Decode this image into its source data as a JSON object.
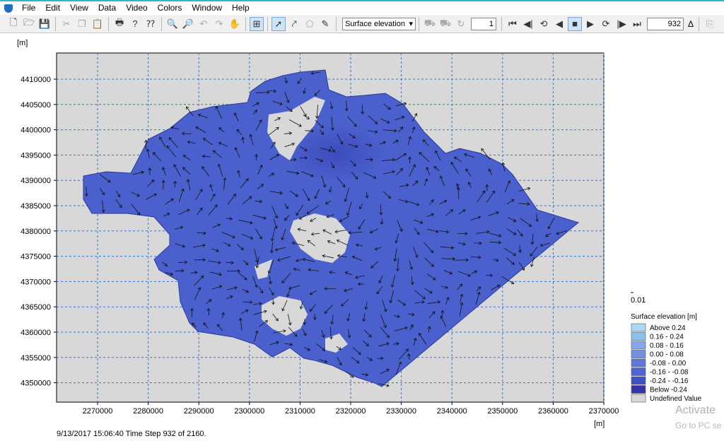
{
  "menu": [
    "File",
    "Edit",
    "View",
    "Data",
    "Video",
    "Colors",
    "Window",
    "Help"
  ],
  "toolbar": {
    "dataset_select": "Surface elevation",
    "step_input": "1",
    "frame_input": "932",
    "delta_label": "Δ"
  },
  "plot": {
    "y_unit": "[m]",
    "x_unit": "[m]",
    "y_ticks": [
      "4410000",
      "4405000",
      "4400000",
      "4395000",
      "4390000",
      "4385000",
      "4380000",
      "4375000",
      "4370000",
      "4365000",
      "4360000",
      "4355000",
      "4350000"
    ],
    "x_ticks": [
      "2270000",
      "2280000",
      "2290000",
      "2300000",
      "2310000",
      "2320000",
      "2330000",
      "2340000",
      "2350000",
      "2360000",
      "2370000"
    ],
    "background": "#d8d8d8",
    "grid_color": "#2d74d6",
    "fill_color": "#4a60cc"
  },
  "legend": {
    "scale_value": "0.01",
    "title": "Surface elevation [m]",
    "items": [
      {
        "label": "Above  0.24",
        "color": "#a8d8f4"
      },
      {
        "label": " 0.16 -  0.24",
        "color": "#8cc1ee"
      },
      {
        "label": " 0.08 -  0.16",
        "color": "#86a6e6"
      },
      {
        "label": " 0.00 -  0.08",
        "color": "#7690e0"
      },
      {
        "label": "-0.08 -  0.00",
        "color": "#5e78d8"
      },
      {
        "label": "-0.16 - -0.08",
        "color": "#4f66cf"
      },
      {
        "label": "-0.24 - -0.16",
        "color": "#3f50c2"
      },
      {
        "label": "Below  -0.24",
        "color": "#3236a8"
      },
      {
        "label": "Undefined Value",
        "color": "#d8d8d8"
      }
    ]
  },
  "status": "9/13/2017 15:06:40  Time Step 932 of 2160.",
  "watermark": {
    "line1": "Activate",
    "line2": "Go to PC se"
  }
}
